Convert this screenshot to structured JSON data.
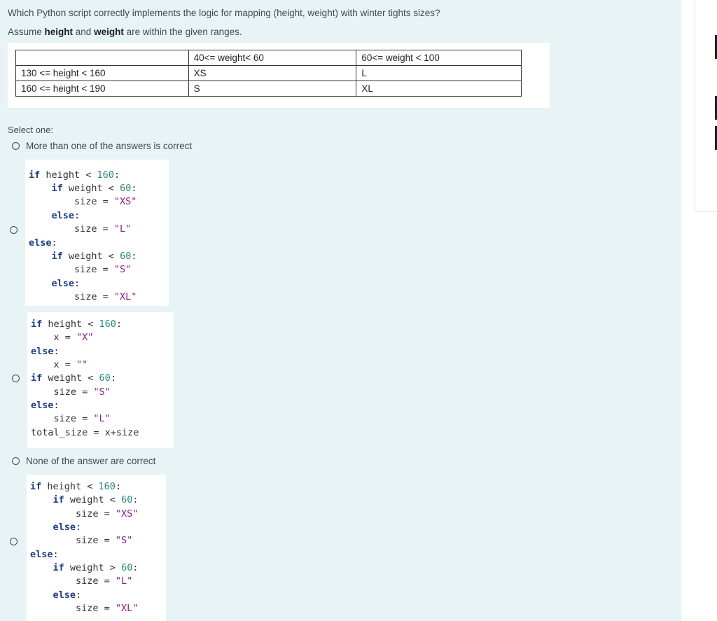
{
  "question": {
    "line1": "Which Python script correctly implements the logic for mapping (height, weight) with winter tights sizes?",
    "line2_pre": "Assume ",
    "line2_b1": "height",
    "line2_mid": " and ",
    "line2_b2": "weight",
    "line2_post": " are within the given ranges."
  },
  "table": {
    "headers": [
      "",
      "40<= weight< 60",
      "60<= weight < 100"
    ],
    "rows": [
      [
        "130 <= height < 160",
        "XS",
        "L"
      ],
      [
        "160 <= height < 190",
        "S",
        "XL"
      ]
    ]
  },
  "select_one": "Select one:",
  "options": {
    "opt1_label": "More than one of the answers is correct",
    "opt3_label": "None of the answer are correct"
  },
  "code_a": [
    "if height < 160:",
    "    if weight < 60:",
    "        size = \"XS\"",
    "    else:",
    "        size = \"L\"",
    "else:",
    "    if weight < 60:",
    "        size = \"S\"",
    "    else:",
    "        size = \"XL\""
  ],
  "code_b": [
    "if height < 160:",
    "    x = \"X\"",
    "else:",
    "    x = \"\"",
    "if weight < 60:",
    "    size = \"S\"",
    "else:",
    "    size = \"L\"",
    "total_size = x+size"
  ],
  "code_c": [
    "if height < 160:",
    "    if weight < 60:",
    "        size = \"XS\"",
    "    else:",
    "        size = \"S\"",
    "else:",
    "    if weight > 60:",
    "        size = \"L\"",
    "    else:",
    "        size = \"XL\""
  ],
  "colors": {
    "panel_bg": "#e7f3f5",
    "keyword": "#1f3d80",
    "number": "#2a8a7a",
    "string": "#8a1e8a"
  }
}
